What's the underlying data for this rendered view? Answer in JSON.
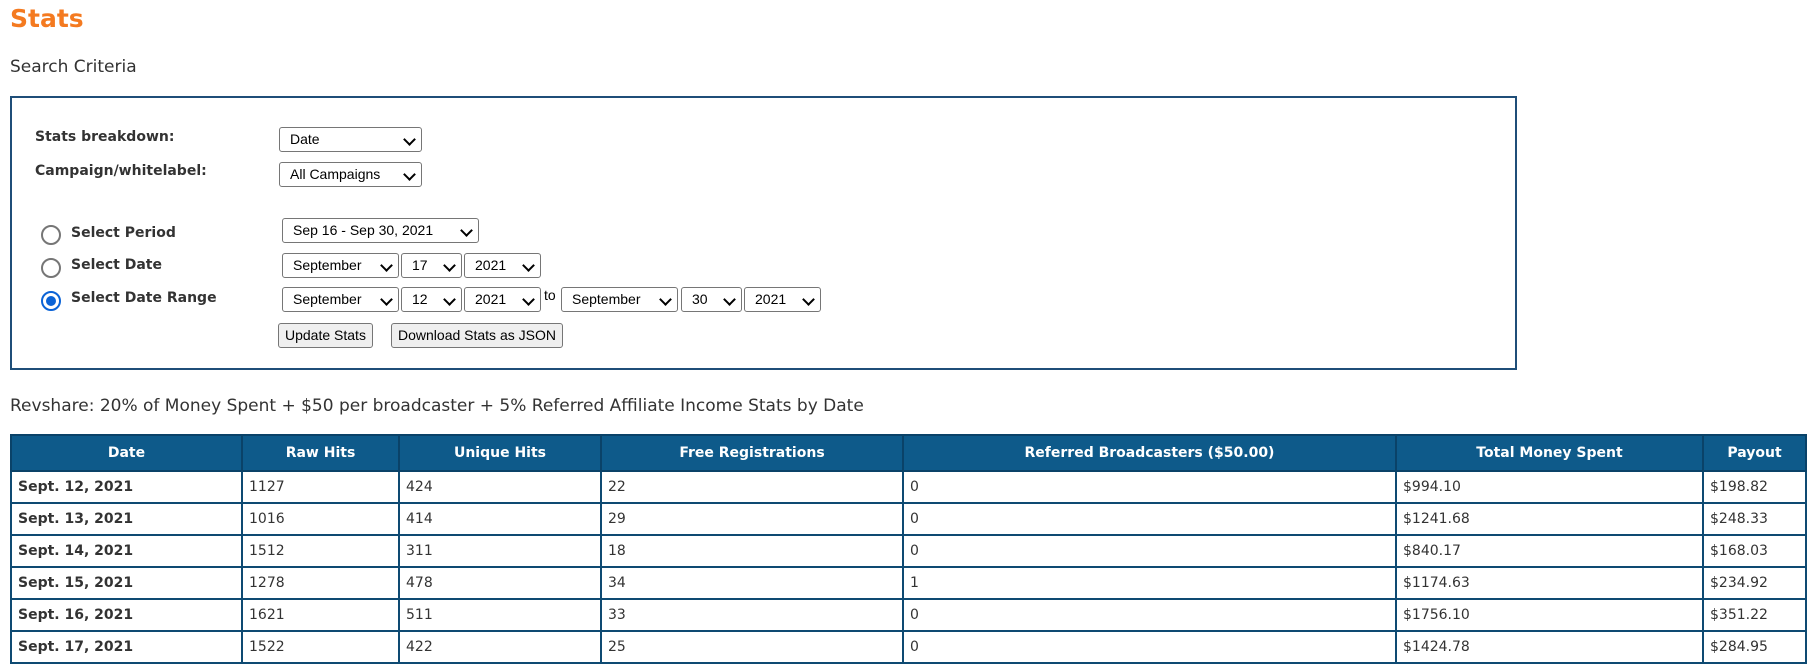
{
  "page": {
    "title": "Stats",
    "search_criteria_title": "Search Criteria"
  },
  "criteria": {
    "breakdown_label": "Stats breakdown:",
    "breakdown_value": "Date",
    "campaign_label": "Campaign/whitelabel:",
    "campaign_value": "All Campaigns",
    "period": {
      "label": "Select Period",
      "value": "Sep 16 - Sep 30, 2021",
      "checked": false
    },
    "date": {
      "label": "Select Date",
      "month": "September",
      "day": "17",
      "year": "2021",
      "checked": false
    },
    "range": {
      "label": "Select Date Range",
      "from_month": "September",
      "from_day": "12",
      "from_year": "2021",
      "to_word": "to",
      "to_month": "September",
      "to_day": "30",
      "to_year": "2021",
      "checked": true
    },
    "update_button": "Update Stats",
    "download_button": "Download Stats as JSON"
  },
  "revshare_title": "Revshare: 20% of Money Spent + $50 per broadcaster + 5% Referred Affiliate Income Stats by Date",
  "table": {
    "headers": [
      "Date",
      "Raw Hits",
      "Unique Hits",
      "Free Registrations",
      "Referred Broadcasters ($50.00)",
      "Total Money Spent",
      "Payout"
    ],
    "rows": [
      [
        "Sept. 12, 2021",
        "1127",
        "424",
        "22",
        "0",
        "$994.10",
        "$198.82"
      ],
      [
        "Sept. 13, 2021",
        "1016",
        "414",
        "29",
        "0",
        "$1241.68",
        "$248.33"
      ],
      [
        "Sept. 14, 2021",
        "1512",
        "311",
        "18",
        "0",
        "$840.17",
        "$168.03"
      ],
      [
        "Sept. 15, 2021",
        "1278",
        "478",
        "34",
        "1",
        "$1174.63",
        "$234.92"
      ],
      [
        "Sept. 16, 2021",
        "1621",
        "511",
        "33",
        "0",
        "$1756.10",
        "$351.22"
      ],
      [
        "Sept. 17, 2021",
        "1522",
        "422",
        "25",
        "0",
        "$1424.78",
        "$284.95"
      ]
    ]
  },
  "colors": {
    "title": "#f47a20",
    "header_bg": "#0e5a8a",
    "box_border": "#1f4e78",
    "radio_accent": "#0b63d6"
  }
}
